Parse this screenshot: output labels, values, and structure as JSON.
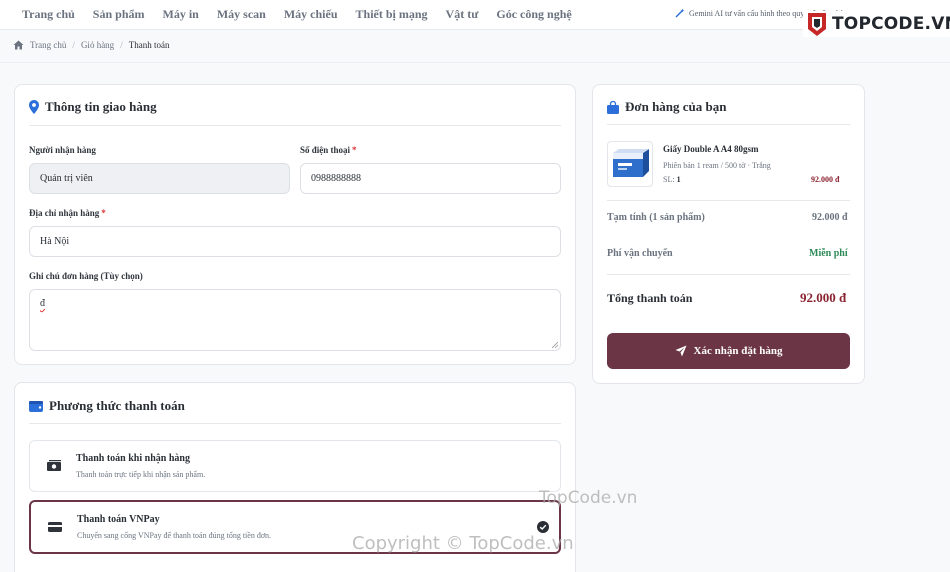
{
  "nav": {
    "items": [
      "Trang chủ",
      "Sản phẩm",
      "Máy in",
      "Máy scan",
      "Máy chiếu",
      "Thiết bị mạng",
      "Vật tư",
      "Góc công nghệ"
    ],
    "gemini_text": "Gemini AI tư vấn cấu hình theo quy mô văn phòng"
  },
  "logo": {
    "text": "TOPCODE.VN"
  },
  "breadcrumb": {
    "home": "Trang chủ",
    "cart": "Giỏ hàng",
    "current": "Thanh toán"
  },
  "shipping": {
    "title": "Thông tin giao hàng",
    "receiver_label": "Người nhận hàng",
    "receiver_value": "Quản trị viên",
    "phone_label": "Số điện thoại",
    "phone_value": "0988888888",
    "address_label": "Địa chỉ nhận hàng",
    "address_value": "Hà Nội",
    "note_label": "Ghi chú đơn hàng (Tùy chọn)",
    "note_value": "đ",
    "required_mark": "*"
  },
  "payment": {
    "title": "Phương thức thanh toán",
    "options": [
      {
        "name": "Thanh toán khi nhận hàng",
        "desc": "Thanh toán trực tiếp khi nhận sản phẩm.",
        "selected": false
      },
      {
        "name": "Thanh toán VNPay",
        "desc": "Chuyển sang cổng VNPay để thanh toán đúng tổng tiền đơn.",
        "selected": true
      }
    ]
  },
  "order": {
    "title": "Đơn hàng của bạn",
    "product": {
      "name": "Giấy Double A A4 80gsm",
      "variant": "Phiên bản 1 ream / 500 tờ · Trắng",
      "qty_label": "SL:",
      "qty": "1",
      "price": "92.000 đ"
    },
    "subtotal_label": "Tạm tính (1 sản phẩm)",
    "subtotal_value": "92.000 đ",
    "shipping_label": "Phí vận chuyển",
    "shipping_value": "Miễn phí",
    "total_label": "Tổng thanh toán",
    "total_value": "92.000 đ",
    "confirm_label": "Xác nhận đặt hàng"
  },
  "watermark": {
    "small": "TopCode.vn",
    "large": "Copyright © TopCode.vn"
  },
  "colors": {
    "accent": "#6b3546",
    "price": "#8a2330",
    "free": "#2e8b57",
    "icon_blue": "#2c6fdb"
  }
}
